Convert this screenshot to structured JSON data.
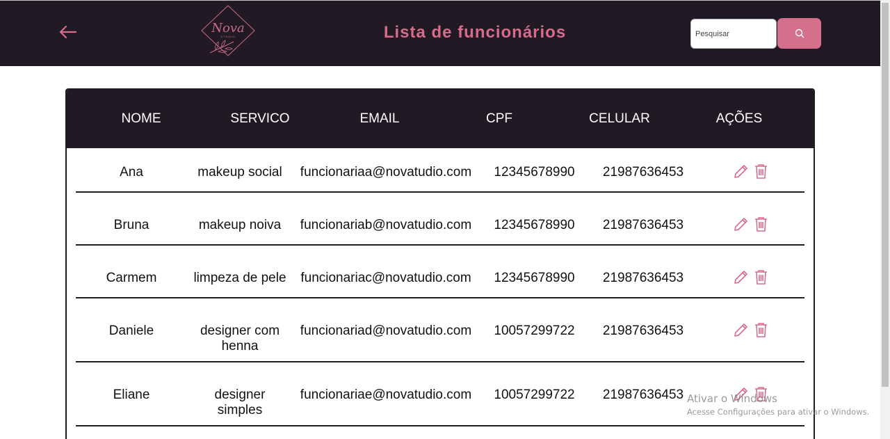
{
  "header": {
    "title": "Lista de funcionários",
    "logo_text": "Nova",
    "logo_sub": "STUDIO",
    "search_placeholder": "Pesquisar",
    "back_icon": "arrow-left-icon",
    "search_icon": "search-icon"
  },
  "colors": {
    "header_bg": "#211a24",
    "accent": "#d96b8a",
    "button_bg": "#d4708c"
  },
  "table": {
    "columns": [
      "NOME",
      "SERVICO",
      "EMAIL",
      "CPF",
      "CELULAR",
      "AÇÕES"
    ],
    "rows": [
      {
        "nome": "Ana",
        "servico": "makeup social",
        "email": "funcionariaa@novatudio.com",
        "cpf": "12345678990",
        "celular": "21987636453"
      },
      {
        "nome": "Bruna",
        "servico": "makeup noiva",
        "email": "funcionariab@novatudio.com",
        "cpf": "12345678990",
        "celular": "21987636453"
      },
      {
        "nome": "Carmem",
        "servico": "limpeza de pele",
        "email": "funcionariac@novatudio.com",
        "cpf": "12345678990",
        "celular": "21987636453"
      },
      {
        "nome": "Daniele",
        "servico": "designer com henna",
        "email": "funcionariad@novatudio.com",
        "cpf": "10057299722",
        "celular": "21987636453"
      },
      {
        "nome": "Eliane",
        "servico": "designer simples",
        "email": "funcionariae@novatudio.com",
        "cpf": "10057299722",
        "celular": "21987636453"
      }
    ],
    "action_icons": [
      "pencil-icon",
      "trash-icon"
    ]
  },
  "watermark": {
    "title": "Ativar o Windows",
    "subtitle": "Acesse Configurações para ativar o Windows."
  }
}
